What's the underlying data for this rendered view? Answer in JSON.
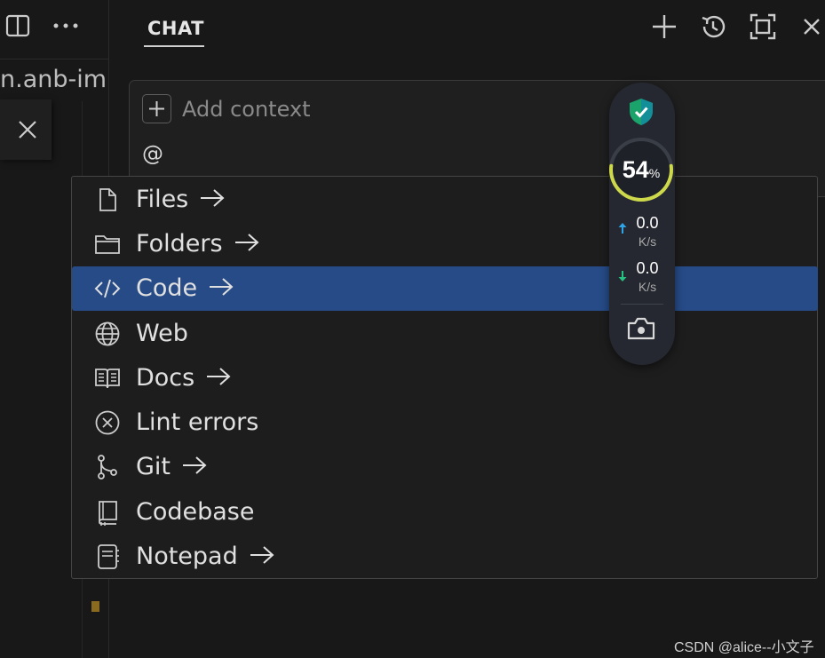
{
  "left_pane": {
    "filename_fragment": "n.anb-imp"
  },
  "chat": {
    "tab_title": "CHAT",
    "header_icons": [
      "plus-icon",
      "history-icon",
      "maximize-icon",
      "close-icon"
    ]
  },
  "input": {
    "add_context_label": "Add context",
    "text": "@"
  },
  "mention_menu": {
    "items": [
      {
        "label": "Files",
        "icon": "file-icon",
        "has_arrow": true
      },
      {
        "label": "Folders",
        "icon": "folder-icon",
        "has_arrow": true
      },
      {
        "label": "Code",
        "icon": "code-icon",
        "has_arrow": true,
        "selected": true
      },
      {
        "label": "Web",
        "icon": "globe-icon",
        "has_arrow": false
      },
      {
        "label": "Docs",
        "icon": "book-icon",
        "has_arrow": true
      },
      {
        "label": "Lint errors",
        "icon": "error-circle-icon",
        "has_arrow": false
      },
      {
        "label": "Git",
        "icon": "git-branch-icon",
        "has_arrow": true
      },
      {
        "label": "Codebase",
        "icon": "codebase-icon",
        "has_arrow": false
      },
      {
        "label": "Notepad",
        "icon": "notepad-icon",
        "has_arrow": true
      }
    ],
    "selected_color": "#264b87"
  },
  "system_widget": {
    "percent_value": "54",
    "percent_unit": "%",
    "upload_value": "0.0",
    "upload_unit": "K/s",
    "download_value": "0.0",
    "download_unit": "K/s",
    "usage_fraction": 0.54
  },
  "watermark": "CSDN @alice--小文子"
}
